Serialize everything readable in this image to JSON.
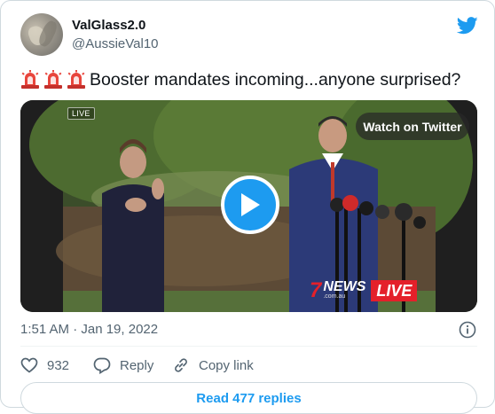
{
  "author": {
    "display_name": "ValGlass2.0",
    "handle": "@AussieVal10",
    "avatar_icon": "profile-photo"
  },
  "brand": {
    "logo_icon": "twitter-bird-icon",
    "color": "#1d9bf0"
  },
  "tweet": {
    "emojis": [
      "rotating-light-icon",
      "rotating-light-icon",
      "rotating-light-icon"
    ],
    "text": "Booster mandates incoming...anyone surprised?"
  },
  "video": {
    "live_tag": "LIVE",
    "watch_label": "Watch on Twitter",
    "play_icon": "play-icon",
    "channel_logo": {
      "number": "7",
      "name": "NEWS",
      "domain": ".com.au",
      "live": "LIVE"
    }
  },
  "timestamp": "1:51 AM · Jan 19, 2022",
  "actions": {
    "like_count": "932",
    "reply_label": "Reply",
    "copy_link_label": "Copy link"
  },
  "read_replies_label": "Read 477 replies",
  "colors": {
    "text_primary": "#0f1419",
    "text_secondary": "#536471",
    "border": "#cfd9de",
    "accent": "#1d9bf0",
    "news_red": "#e4202a"
  }
}
